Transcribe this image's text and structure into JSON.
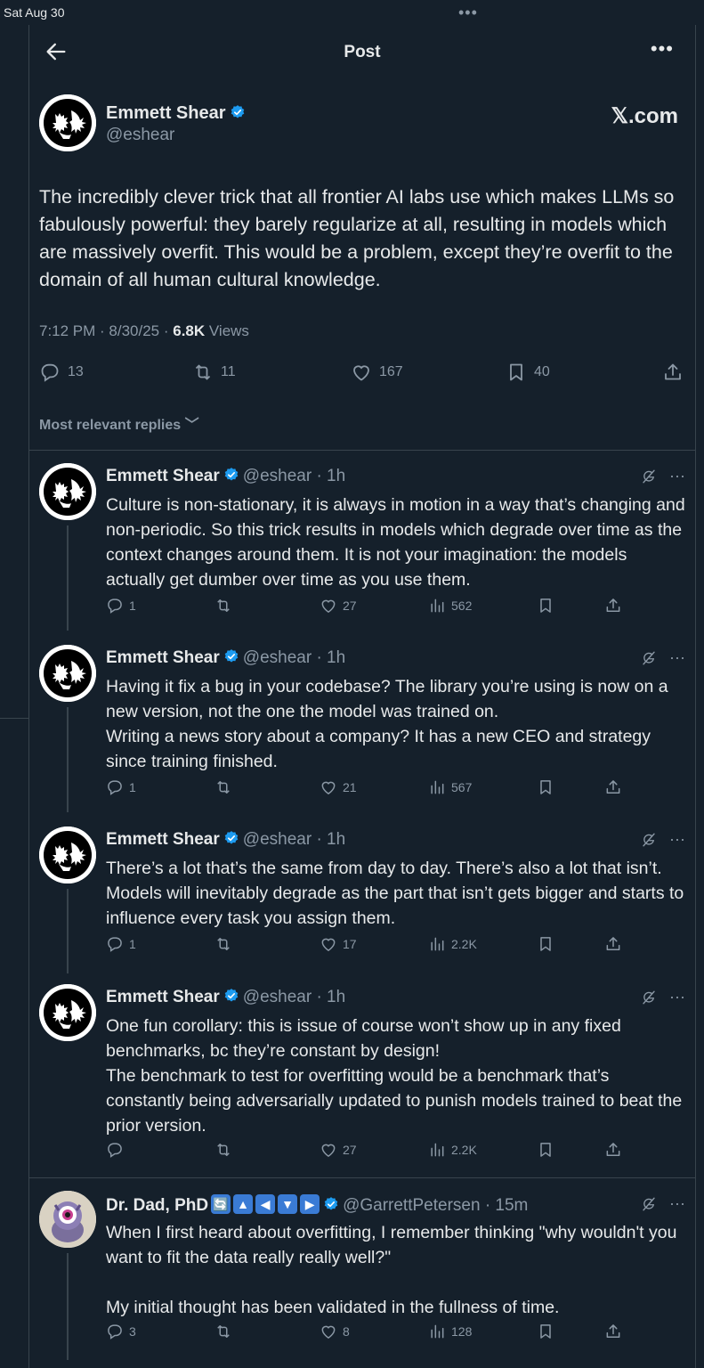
{
  "status_bar": {
    "time": "Sat Aug 30",
    "dots": "•••"
  },
  "header": {
    "title": "Post",
    "more": "•••"
  },
  "post": {
    "author_name": "Emmett Shear",
    "author_handle": "@eshear",
    "source_label": "𝕏.com",
    "text": "The incredibly clever trick that all frontier AI labs use which makes LLMs so fabulously powerful: they barely regularize at all, resulting in models which are massively overfit. This would be a problem, except they’re overfit to the domain of all human cultural knowledge.",
    "time": "7:12 PM · 8/30/25 · ",
    "views_count": "6.8K",
    "views_label": " Views",
    "replies": "13",
    "reposts": "11",
    "likes": "167",
    "bookmarks": "40"
  },
  "sort_label": "Most relevant replies",
  "colors": {
    "background": "#15202b",
    "text": "#e7e9ea",
    "muted": "#8b98a5",
    "verified": "#1d9bf0",
    "divider": "#38444d"
  },
  "replies": [
    {
      "name": "Emmett Shear",
      "handle": "@eshear · 1h",
      "text": "Culture is non-stationary, it is always in motion in a way that’s changing and non-periodic. So this trick results in models which degrade over time as the context changes around them. It is not your imagination: the models actually get dumber over time as you use them.",
      "replies": "1",
      "reposts": "",
      "likes": "27",
      "views": "562"
    },
    {
      "name": "Emmett Shear",
      "handle": "@eshear · 1h",
      "text": "Having it fix a bug in your codebase? The library you’re using is now on a new version, not the one the model was trained on.\nWriting a news story about a company? It has a new CEO and strategy since training finished.",
      "replies": "1",
      "reposts": "",
      "likes": "21",
      "views": "567"
    },
    {
      "name": "Emmett Shear",
      "handle": "@eshear · 1h",
      "text": "There’s a lot that’s the same from day to day. There’s also a lot that isn’t. Models will inevitably degrade as the part that isn’t gets bigger and starts to influence every task you assign them.",
      "replies": "1",
      "reposts": "",
      "likes": "17",
      "views": "2.2K"
    },
    {
      "name": "Emmett Shear",
      "handle": "@eshear · 1h",
      "text": "One fun corollary: this is issue of course won’t show up in any fixed benchmarks, bc they’re constant by design!\nThe benchmark to test for overfitting would be a benchmark that’s constantly being adversarially updated to punish models trained to beat the prior version.",
      "replies": "",
      "reposts": "",
      "likes": "27",
      "views": "2.2K"
    },
    {
      "name": "Dr. Dad, PhD",
      "name_badges": [
        "🔄",
        "▲",
        "◀",
        "▼",
        "▶"
      ],
      "handle": "@GarrettPetersen · 15m",
      "text": "When I first heard about overfitting, I remember thinking \"why wouldn't you want to fit the data really really well?\"\n\nMy initial thought has been validated in the fullness of time.",
      "replies": "3",
      "reposts": "",
      "likes": "8",
      "views": "128"
    }
  ]
}
